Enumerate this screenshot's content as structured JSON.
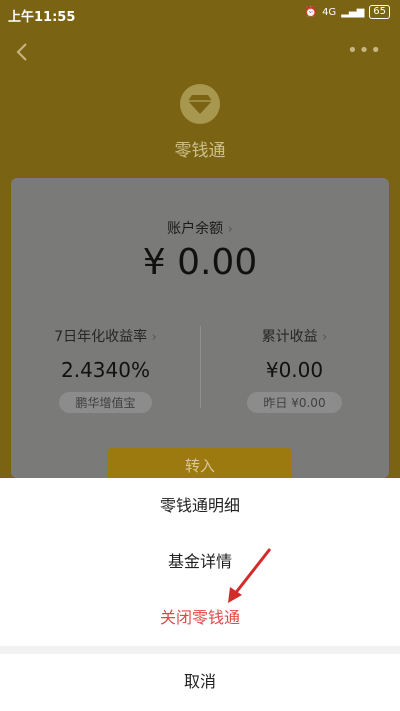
{
  "status_bar": {
    "time": "上午11:55",
    "network": "4G",
    "battery": "65"
  },
  "header": {
    "app_name": "零钱通"
  },
  "card": {
    "balance_label": "账户余额",
    "balance_value": "¥ 0.00",
    "left": {
      "label": "7日年化收益率",
      "value": "2.4340%",
      "pill": "鹏华增值宝"
    },
    "right": {
      "label": "累计收益",
      "value": "¥0.00",
      "pill": "昨日 ¥0.00"
    },
    "transfer_label": "转入"
  },
  "sheet": {
    "items": [
      "零钱通明细",
      "基金详情",
      "关闭零钱通"
    ],
    "cancel_label": "取消"
  },
  "colors": {
    "danger": "#e04848",
    "annotation_arrow": "#d42a2a"
  }
}
